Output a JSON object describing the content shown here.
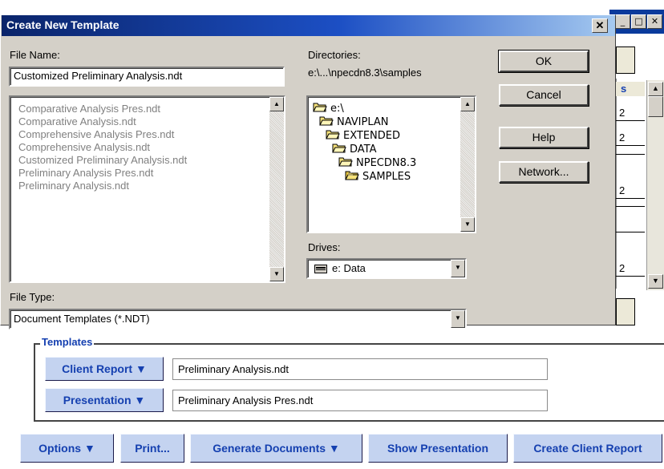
{
  "dialog": {
    "title": "Create New Template",
    "close_label": "✕",
    "file_name_label": "File Name:",
    "file_name_value": "Customized Preliminary Analysis.ndt",
    "files": [
      "Comparative Analysis Pres.ndt",
      "Comparative Analysis.ndt",
      "Comprehensive Analysis Pres.ndt",
      "Comprehensive Analysis.ndt",
      "Customized Preliminary Analysis.ndt",
      "Preliminary Analysis Pres.ndt",
      "Preliminary Analysis.ndt"
    ],
    "directories_label": "Directories:",
    "directories_path": "e:\\...\\npecdn8.3\\samples",
    "directories": [
      "e:\\",
      "NAVIPLAN",
      "EXTENDED",
      "DATA",
      "NPECDN8.3",
      "SAMPLES"
    ],
    "drives_label": "Drives:",
    "drive_value": "e: Data",
    "file_type_label": "File Type:",
    "file_type_value": "Document Templates (*.NDT)",
    "buttons": {
      "ok": "OK",
      "cancel": "Cancel",
      "help": "Help",
      "network": "Network..."
    }
  },
  "background": {
    "table_header": "s",
    "table_values": [
      "2",
      "2",
      "2",
      "2"
    ],
    "templates_legend": "Templates",
    "client_report_label": "Client Report ▼",
    "client_report_value": "Preliminary Analysis.ndt",
    "presentation_label": "Presentation ▼",
    "presentation_value": "Preliminary Analysis Pres.ndt",
    "bottom_buttons": {
      "options": "Options ▼",
      "print": "Print...",
      "generate": "Generate Documents ▼",
      "show_presentation": "Show Presentation",
      "create_client_report": "Create Client Report"
    }
  },
  "colors": {
    "dialog_face": "#d4d0c8",
    "title_start": "#0a246a",
    "title_end": "#a6caf0",
    "link_blue": "#1540b0",
    "blue_button": "#c4d3f0"
  }
}
